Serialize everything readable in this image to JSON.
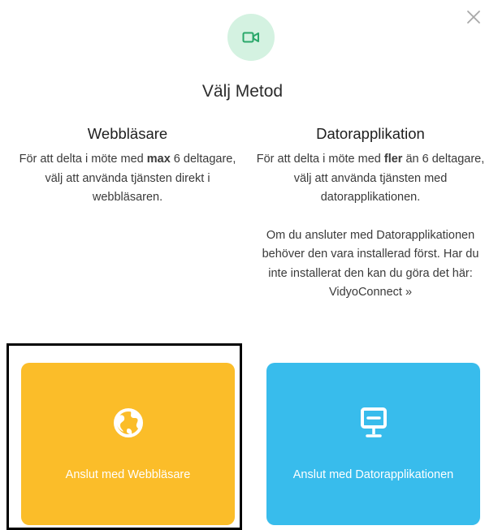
{
  "dialog": {
    "title": "Välj Metod",
    "icons": {
      "header": "video-camera-icon",
      "close": "close-icon"
    },
    "colors": {
      "badge_bg": "#d4f2e1",
      "badge_icon": "#2aa86a"
    }
  },
  "web": {
    "heading": "Webbläsare",
    "desc_1": "För att delta i möte med ",
    "desc_bold": "max",
    "desc_2": " 6 deltagare, välj att använda tjänsten direkt i webbläsaren.",
    "button_label": "Anslut med Webbläsare",
    "icon": "globe-icon",
    "color": "#fbbd29"
  },
  "app": {
    "heading": "Datorapplikation",
    "desc_1": "För att delta i möte med ",
    "desc_bold": "fler",
    "desc_2": " än 6 deltagare, välj att använda tjänsten med datorapplikationen.",
    "note": "Om du ansluter med Datorapplikationen behöver den vara installerad först. Har du inte installerat den kan du göra det här: VidyoConnect »",
    "button_label": "Anslut med Datorapplikationen",
    "icon": "desktop-monitor-icon",
    "color": "#38bcec"
  }
}
